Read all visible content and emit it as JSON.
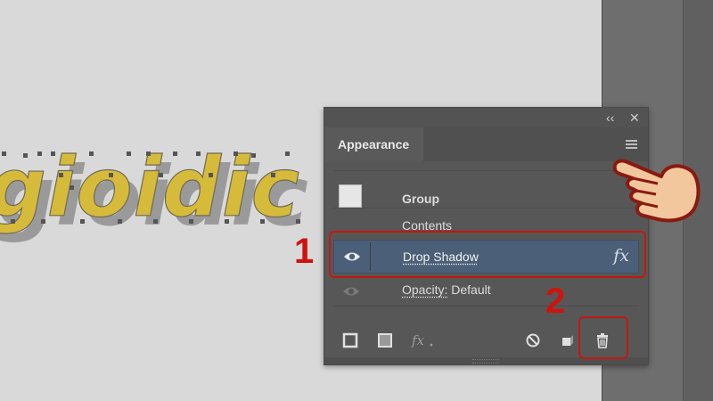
{
  "artwork": {
    "text": "gioidic"
  },
  "panel": {
    "collapse_glyph": "‹‹",
    "close_glyph": "✕",
    "tab_label": "Appearance",
    "menu_icon": "hamburger-menu-icon",
    "rows": {
      "group_label": "Group",
      "contents_label": "Contents",
      "drop_shadow_label": "Drop Shadow",
      "fx_glyph": "fx",
      "opacity_label": "Opacity:",
      "opacity_value": "Default"
    },
    "footer_icons": [
      "add-stroke-icon",
      "add-fill-icon",
      "fx-menu-icon",
      "clear-appearance-icon",
      "duplicate-item-icon",
      "delete-item-icon"
    ]
  },
  "annotations": {
    "step1": "1",
    "step2": "2"
  },
  "colors": {
    "panel_bg": "#575757",
    "selected_row": "#4b6078",
    "annotation_red": "#c4170f",
    "artwork_yellow": "#d6bb3b"
  }
}
